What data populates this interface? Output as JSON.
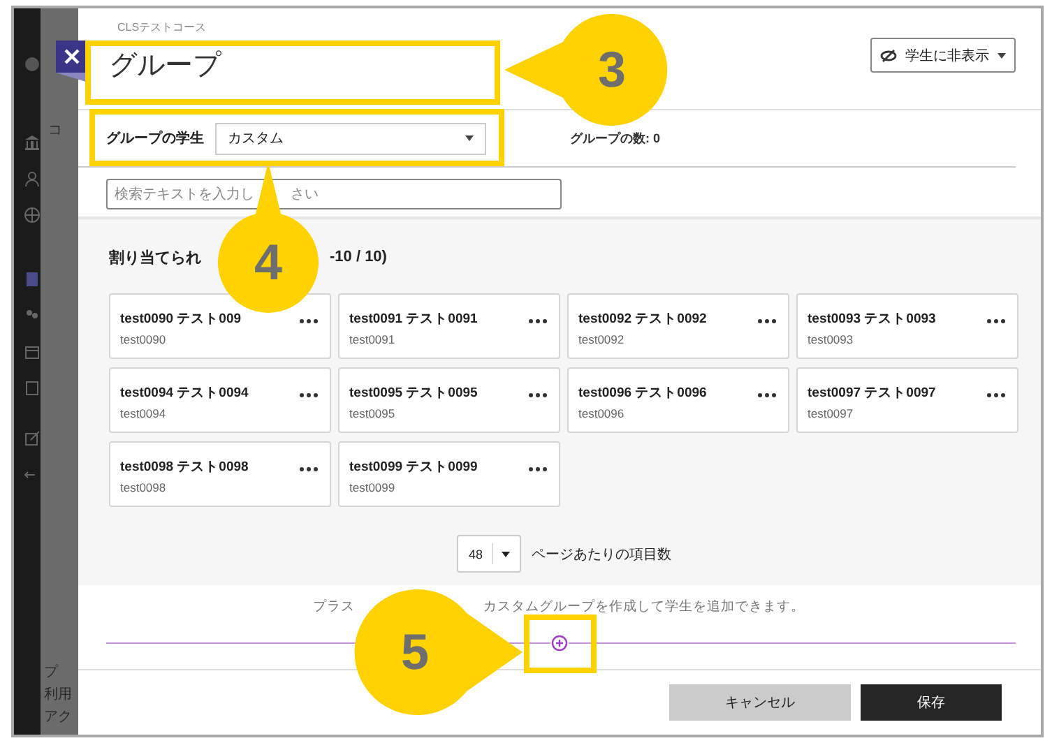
{
  "background": {
    "breadcrumb": "CLSテストコース",
    "fragments": [
      "コ",
      "プ",
      "利用",
      "アク"
    ]
  },
  "title_field": {
    "value": "グループ"
  },
  "visibility_button": {
    "label": "学生に非表示"
  },
  "group_students": {
    "label": "グループの学生",
    "value": "カスタム"
  },
  "group_count": "グループの数: 0",
  "search": {
    "placeholder_parts": [
      "検索テキストを入力し",
      "さい"
    ]
  },
  "unassigned": {
    "heading_parts": [
      "割り当てられ",
      "-10 / 10)"
    ]
  },
  "students": [
    {
      "name": "test0090 テスト009",
      "id": "test0090"
    },
    {
      "name": "test0091 テスト0091",
      "id": "test0091"
    },
    {
      "name": "test0092 テスト0092",
      "id": "test0092"
    },
    {
      "name": "test0093 テスト0093",
      "id": "test0093"
    },
    {
      "name": "test0094 テスト0094",
      "id": "test0094"
    },
    {
      "name": "test0095 テスト0095",
      "id": "test0095"
    },
    {
      "name": "test0096 テスト0096",
      "id": "test0096"
    },
    {
      "name": "test0097 テスト0097",
      "id": "test0097"
    },
    {
      "name": "test0098 テスト0098",
      "id": "test0098"
    },
    {
      "name": "test0099 テスト0099",
      "id": "test0099"
    }
  ],
  "pager": {
    "per_page": "48",
    "label": "ページあたりの項目数"
  },
  "add_hint": {
    "parts": [
      "プラス",
      "カスタムグループを作成して学生を追加できます。"
    ]
  },
  "buttons": [
    {
      "kind": "secondary",
      "label": "キャンセル"
    },
    {
      "kind": "primary",
      "label": "保存"
    }
  ],
  "callouts": [
    {
      "number": "3"
    },
    {
      "number": "4"
    },
    {
      "number": "5"
    }
  ]
}
